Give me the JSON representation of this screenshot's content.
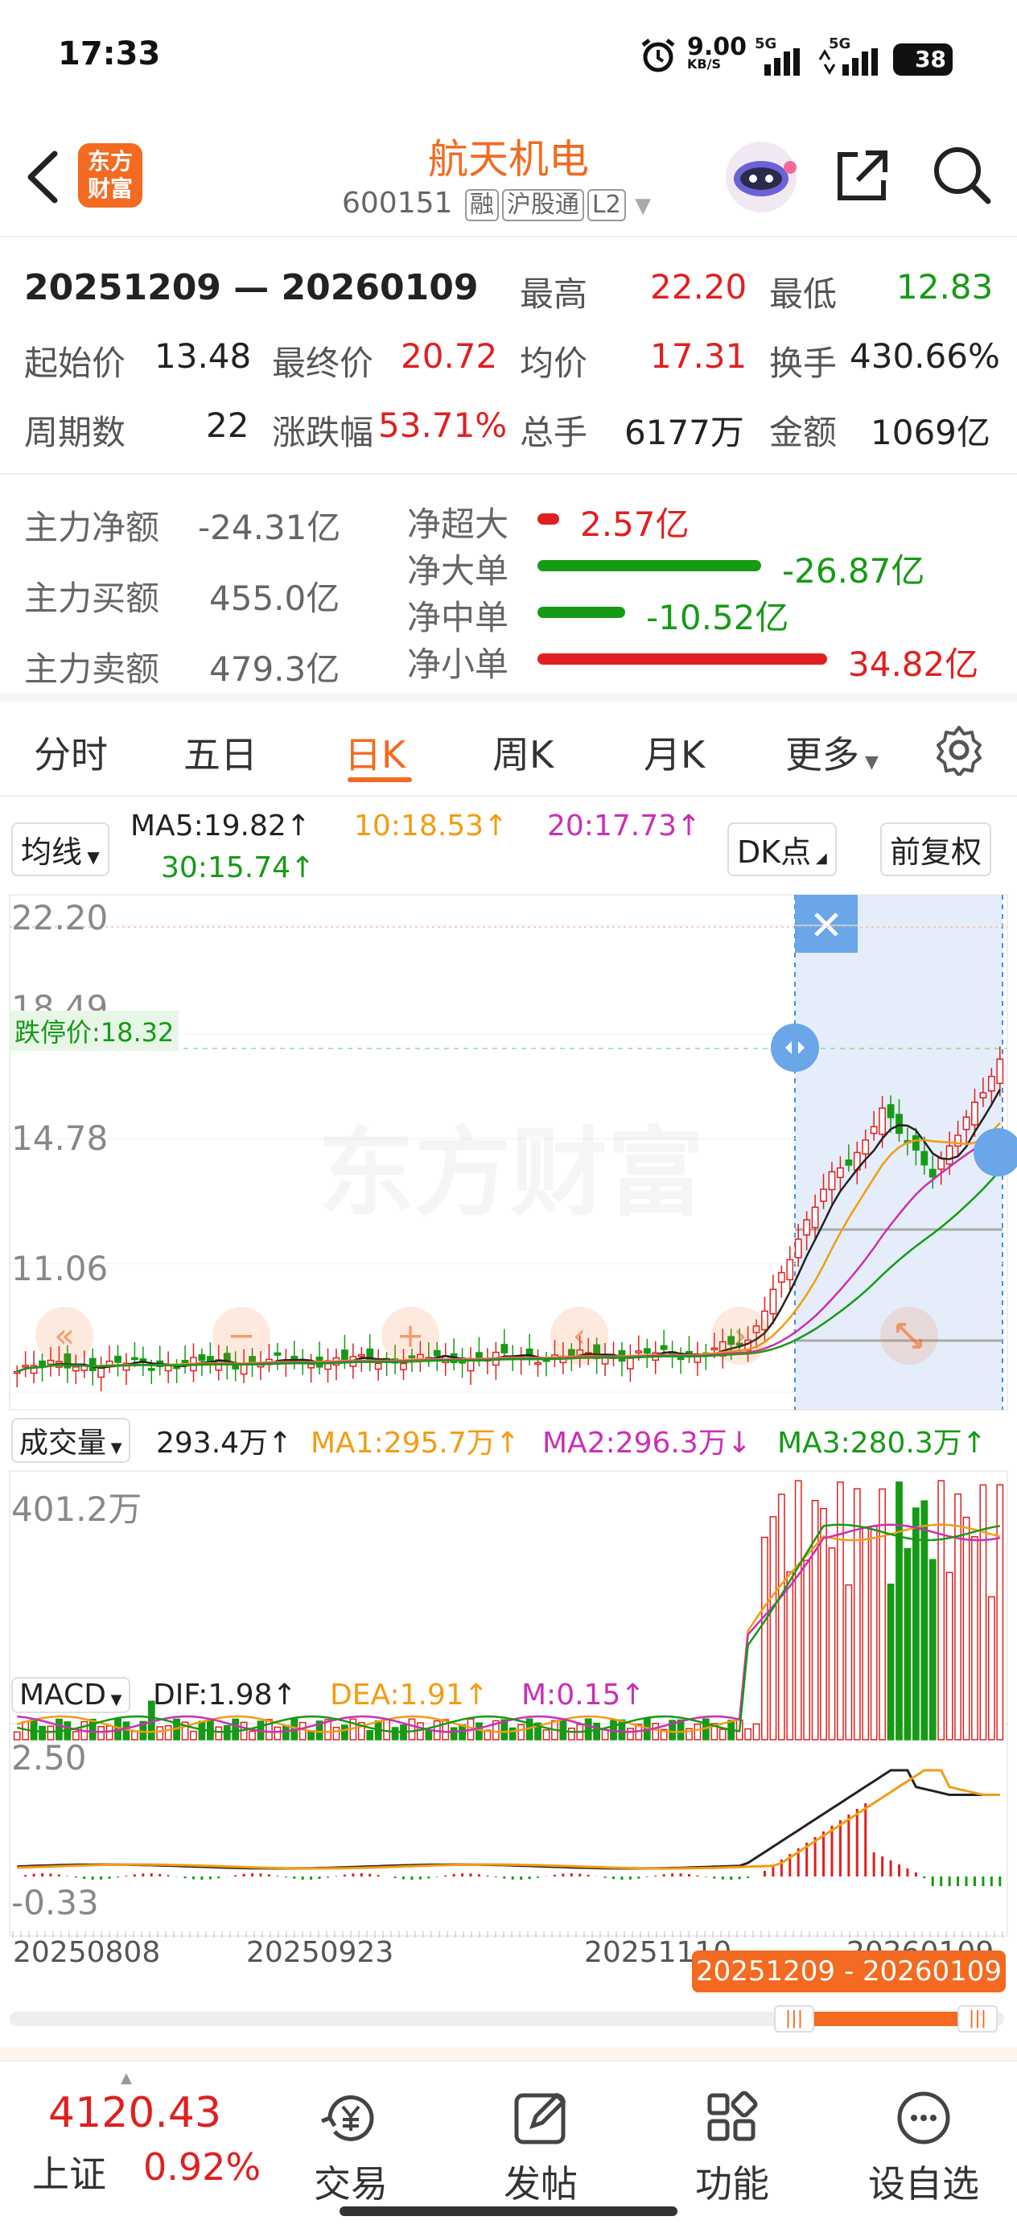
{
  "status_bar": {
    "time": "17:33",
    "net_speed": "9.00",
    "net_unit": "KB/S",
    "signal_1": "5G",
    "signal_2": "5G",
    "battery": "38"
  },
  "header": {
    "logo_text": "东方财富",
    "title": "航天机电",
    "code": "600151",
    "tags": [
      "融",
      "沪股通",
      "L2"
    ]
  },
  "period": {
    "range": "20251209 — 20260109",
    "high_label": "最高",
    "high": "22.20",
    "low_label": "最低",
    "low": "12.83",
    "start_label": "起始价",
    "start": "13.48",
    "end_label": "最终价",
    "end": "20.72",
    "avg_label": "均价",
    "avg": "17.31",
    "turnover_label": "换手",
    "turnover": "430.66%",
    "days_label": "周期数",
    "days": "22",
    "change_label": "涨跌幅",
    "change": "53.71%",
    "volume_label": "总手",
    "volume": "6177万",
    "amount_label": "金额",
    "amount": "1069亿"
  },
  "capital": {
    "net_label": "主力净额",
    "net": "-24.31亿",
    "buy_label": "主力买额",
    "buy": "455.0亿",
    "sell_label": "主力卖额",
    "sell": "479.3亿",
    "flows": [
      {
        "label": "净超大",
        "value": "2.57亿",
        "color": "#e02020",
        "amount": 2.57
      },
      {
        "label": "净大单",
        "value": "-26.87亿",
        "color": "#169a16",
        "amount": -26.87
      },
      {
        "label": "净中单",
        "value": "-10.52亿",
        "color": "#169a16",
        "amount": -10.52
      },
      {
        "label": "净小单",
        "value": "34.82亿",
        "color": "#e02020",
        "amount": 34.82
      }
    ]
  },
  "tabs": [
    "分时",
    "五日",
    "日K",
    "周K",
    "月K",
    "更多"
  ],
  "active_tab": "日K",
  "chart_controls": {
    "ma_select": "均线",
    "ma5": "MA5:19.82↑",
    "ma10": "10:18.53↑",
    "ma20": "20:17.73↑",
    "ma30": "30:15.74↑",
    "dk_button": "DK点",
    "adjust_button": "前复权",
    "limit_down": "跌停价:18.32",
    "watermark": "东方财富",
    "volume_select": "成交量",
    "vol_value": "293.4万↑",
    "vol_ma1": "MA1:295.7万↑",
    "vol_ma2": "MA2:296.3万↓",
    "vol_ma3": "MA3:280.3万↑",
    "vol_axis_max": "401.2万",
    "macd_select": "MACD",
    "dif": "DIF:1.98↑",
    "dea": "DEA:1.91↑",
    "m": "M:0.15↑",
    "macd_axis_top": "2.50",
    "macd_axis_bottom": "-0.33",
    "dates": [
      "20250808",
      "20250923",
      "20251110",
      "20260109"
    ],
    "selection_badge": "20251209 - 20260109"
  },
  "colors": {
    "up": "#e02020",
    "down": "#169a16",
    "ma5": "#222222",
    "ma10": "#f39c12",
    "ma20": "#cc2fb4",
    "ma30": "#169a16",
    "accent": "#f36a20"
  },
  "chart_data": {
    "type": "candlestick",
    "y_ticks": [
      "22.20",
      "18.49",
      "14.78",
      "11.06"
    ],
    "ylim": [
      7.3,
      22.2
    ],
    "volume_axis_max": 401.2,
    "macd_axis": [
      -0.33,
      2.5
    ]
  },
  "bottom_nav": {
    "index_value": "4120.43",
    "index_name": "上证",
    "index_change": "0.92%",
    "items": [
      {
        "label": "交易",
        "icon": "trade-icon"
      },
      {
        "label": "发帖",
        "icon": "post-icon"
      },
      {
        "label": "功能",
        "icon": "grid-icon"
      },
      {
        "label": "设自选",
        "icon": "favorite-icon"
      }
    ]
  }
}
